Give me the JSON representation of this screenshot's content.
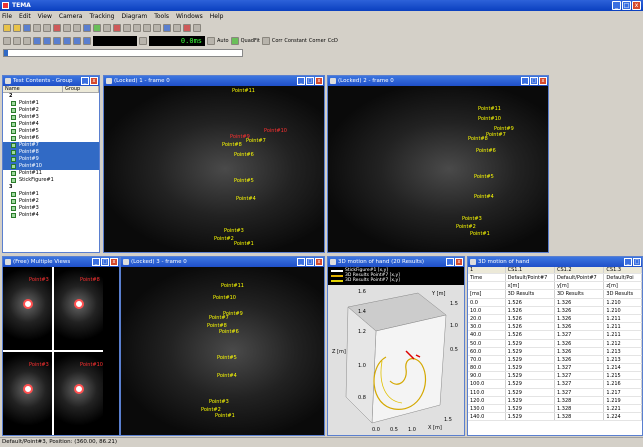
{
  "app": {
    "title": "TEMA"
  },
  "menu": [
    "File",
    "Edit",
    "View",
    "Camera",
    "Tracking",
    "Diagram",
    "Tools",
    "Windows",
    "Help"
  ],
  "toolbar": {
    "time_display": "0.0ms",
    "zoom_display": "0.0",
    "auto_label": "Auto",
    "quadfitting_label": "QuadFit",
    "corr_label": "Corr",
    "constant_label": "Constant",
    "corner_label": "Corner",
    "ccd_label": "CcD"
  },
  "test_contents": {
    "title": "Test Contents - Group",
    "col_name": "Name",
    "col_group": "Group",
    "items": [
      {
        "label": "2",
        "group": true
      },
      {
        "label": "Point#1"
      },
      {
        "label": "Point#2"
      },
      {
        "label": "Point#3"
      },
      {
        "label": "Point#4"
      },
      {
        "label": "Point#5"
      },
      {
        "label": "Point#6"
      },
      {
        "label": "Point#7",
        "selected": true
      },
      {
        "label": "Point#8",
        "selected": true
      },
      {
        "label": "Point#9",
        "selected": true
      },
      {
        "label": "Point#10",
        "selected": true
      },
      {
        "label": "Point#11"
      },
      {
        "label": "StickFigure#1"
      },
      {
        "label": "3",
        "group": true
      },
      {
        "label": "Point#1"
      },
      {
        "label": "Point#2"
      },
      {
        "label": "Point#3"
      },
      {
        "label": "Point#4"
      }
    ]
  },
  "windows": {
    "v1_title": "(Locked) 1 - frame 0",
    "v2_title": "(Locked) 2 - frame 0",
    "v3_title": "(Locked) 3 - frame 0",
    "mv_title": "(Free) Multiple Views",
    "plot_title": "3D motion of hand (20 Results)",
    "table_title": "3D motion of hand"
  },
  "v1_markers": [
    "Point#11",
    "Point#10",
    "Point#9",
    "Point#7",
    "Point#8",
    "Point#6",
    "Point#5",
    "Point#4",
    "Point#3",
    "Point#2",
    "Point#1"
  ],
  "v2_markers": [
    "Point#11",
    "Point#10",
    "Point#9",
    "Point#7",
    "Point#8",
    "Point#6",
    "Point#5",
    "Point#4",
    "Point#3",
    "Point#2",
    "Point#1"
  ],
  "v3_markers": [
    "Point#11",
    "Point#10",
    "Point#9",
    "Point#7",
    "Point#8",
    "Point#6",
    "Point#5",
    "Point#4",
    "Point#3",
    "Point#2",
    "Point#1"
  ],
  "mv_labels": [
    "Point#3",
    "Point#8",
    "Point#3",
    "Point#10"
  ],
  "plot": {
    "legend": [
      "StickFigure#1 [x,y]",
      "3D Results Point#7 [x,y]",
      "3D Results Point#7 [x,y]"
    ],
    "zlabel": "Z [m]",
    "ylabel": "Y [m]",
    "xlabel": "X [m]",
    "ticks_z": [
      "1.6",
      "1.4",
      "1.2",
      "1.0",
      "0.8"
    ],
    "ticks_y": [
      "1.5",
      "1.0",
      "0.5"
    ],
    "ticks_x": [
      "0.0",
      "0.5",
      "1.0",
      "1.5"
    ]
  },
  "table": {
    "headers": [
      "1",
      "CS1.1",
      "CS1.2",
      "CS1.3"
    ],
    "sub1": [
      "Time",
      "Default/Point#7",
      "Default/Point#7",
      "Default/Poi"
    ],
    "sub2": [
      "",
      "x[m]",
      "y[m]",
      "z[m]"
    ],
    "sub3": [
      "[ms]",
      "3D Results",
      "3D Results",
      "3D Results"
    ],
    "rows": [
      [
        "0.0",
        "1.526",
        "1.326",
        "1.210"
      ],
      [
        "10.0",
        "1.526",
        "1.326",
        "1.210"
      ],
      [
        "20.0",
        "1.526",
        "1.326",
        "1.211"
      ],
      [
        "30.0",
        "1.526",
        "1.326",
        "1.211"
      ],
      [
        "40.0",
        "1.526",
        "1.327",
        "1.211"
      ],
      [
        "50.0",
        "1.529",
        "1.326",
        "1.212"
      ],
      [
        "60.0",
        "1.529",
        "1.326",
        "1.213"
      ],
      [
        "70.0",
        "1.529",
        "1.326",
        "1.213"
      ],
      [
        "80.0",
        "1.529",
        "1.327",
        "1.214"
      ],
      [
        "90.0",
        "1.529",
        "1.327",
        "1.215"
      ],
      [
        "100.0",
        "1.529",
        "1.327",
        "1.216"
      ],
      [
        "110.0",
        "1.529",
        "1.327",
        "1.217"
      ],
      [
        "120.0",
        "1.529",
        "1.328",
        "1.219"
      ],
      [
        "130.0",
        "1.529",
        "1.328",
        "1.221"
      ],
      [
        "140.0",
        "1.529",
        "1.328",
        "1.224"
      ]
    ]
  },
  "status": {
    "text": "Default/Point#3, Position: (360.00, 86.21)"
  }
}
